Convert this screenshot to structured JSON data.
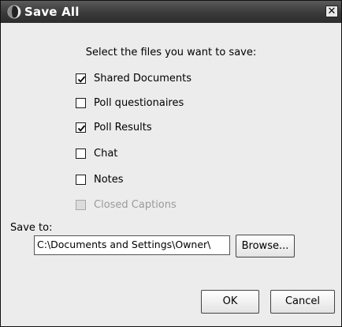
{
  "dialog": {
    "title": "Save All",
    "close_glyph": "✕"
  },
  "prompt": "Select the files you want to save:",
  "files": [
    {
      "label": "Shared Documents",
      "checked": true,
      "enabled": true
    },
    {
      "label": "Poll questionaires",
      "checked": false,
      "enabled": true
    },
    {
      "label": "Poll Results",
      "checked": true,
      "enabled": true
    },
    {
      "label": "Chat",
      "checked": false,
      "enabled": true
    },
    {
      "label": "Notes",
      "checked": false,
      "enabled": true
    },
    {
      "label": "Closed Captions",
      "checked": false,
      "enabled": false
    }
  ],
  "save_to": {
    "label": "Save to:",
    "path": "C:\\Documents and Settings\\Owner\\"
  },
  "buttons": {
    "browse": "Browse...",
    "ok": "OK",
    "cancel": "Cancel"
  },
  "icons": {
    "title": "app-logo-icon",
    "close": "close-icon",
    "check": "checkmark-icon"
  }
}
